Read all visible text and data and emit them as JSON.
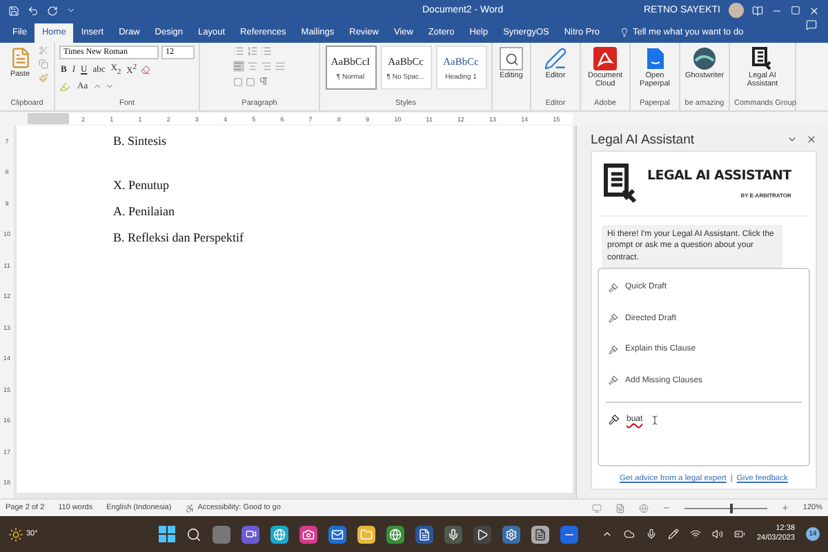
{
  "title_bar": {
    "title": "Document2 - Word",
    "user": "RETNO SAYEKTI"
  },
  "tabs": [
    {
      "label": "File",
      "selected": false
    },
    {
      "label": "Home",
      "selected": true
    },
    {
      "label": "Insert",
      "selected": false
    },
    {
      "label": "Draw",
      "selected": false
    },
    {
      "label": "Design",
      "selected": false
    },
    {
      "label": "Layout",
      "selected": false
    },
    {
      "label": "References",
      "selected": false
    },
    {
      "label": "Mailings",
      "selected": false
    },
    {
      "label": "Review",
      "selected": false
    },
    {
      "label": "View",
      "selected": false
    },
    {
      "label": "Zotero",
      "selected": false
    },
    {
      "label": "Help",
      "selected": false
    },
    {
      "label": "SynergyOS",
      "selected": false
    },
    {
      "label": "Nitro Pro",
      "selected": false
    }
  ],
  "tell_me": "Tell me what you want to do",
  "ribbon": {
    "clipboard": {
      "label": "Clipboard",
      "paste": "Paste"
    },
    "font": {
      "label": "Font",
      "font_name": "Times New Roman",
      "font_size": "12",
      "format_buttons": [
        "B",
        "I",
        "U",
        "abc",
        "X$_{2}$",
        "X$^{2}$"
      ],
      "case_button": "Aa"
    },
    "paragraph": {
      "label": "Paragraph"
    },
    "styles": {
      "label": "Styles",
      "items": [
        {
          "sample": "AaBbCcI",
          "name": "¶ Normal",
          "selected": true
        },
        {
          "sample": "AaBbCc",
          "name": "¶ No Spac...",
          "selected": false
        },
        {
          "sample": "AaBbCc",
          "name": "Heading 1",
          "selected": false
        }
      ]
    },
    "addins": [
      {
        "kind": "editing",
        "label": "Editing"
      },
      {
        "kind": "editor",
        "label": "Editor",
        "group": "Editor"
      },
      {
        "kind": "pdf",
        "label": "Document Cloud",
        "group": "Adobe"
      },
      {
        "kind": "paperpal",
        "label": "Open Paperpal",
        "group": "Paperpal"
      },
      {
        "kind": "ghost",
        "label": "Ghostwriter",
        "group": "be amazing"
      },
      {
        "kind": "legal",
        "label": "Legal AI Assistant",
        "group": "Commands Group"
      }
    ]
  },
  "ruler": {
    "horizontal": [
      "2",
      "1",
      "1",
      "2",
      "3",
      "4",
      "5",
      "6",
      "7",
      "8",
      "9",
      "10",
      "11",
      "12",
      "13",
      "14",
      "15"
    ],
    "vertical": [
      "7",
      "8",
      "9",
      "10",
      "11",
      "12",
      "13",
      "14",
      "15",
      "16",
      "17",
      "18"
    ]
  },
  "document": {
    "sections": [
      [
        "B. Sintesis"
      ],
      [
        "X. Penutup",
        "A. Penilaian",
        "B. Refleksi dan Perspektif"
      ]
    ]
  },
  "panel": {
    "title": "Legal AI Assistant",
    "logo_title": "LEGAL AI ASSISTANT",
    "logo_byline": "BY E-ARBITRATOR",
    "greeting": "Hi there! I'm your Legal AI Assistant. Click the prompt or ask me a question about your contract.",
    "prompts": [
      "Quick Draft",
      "Directed Draft",
      "Explain this Clause",
      "Add Missing Clauses"
    ],
    "input": {
      "value": "buat"
    },
    "links": [
      "Get advice from a legal expert",
      "Give feedback"
    ],
    "separator": "|"
  },
  "status_bar": {
    "items": [
      "Page 2 of 2",
      "110 words",
      "English (Indonesia)",
      "Accessibility: Good to go"
    ],
    "zoom": {
      "level": 0.55,
      "reading": "120%"
    }
  },
  "taskbar": {
    "weather": "30°",
    "time": "12:38",
    "date": "24/03/2023",
    "notifications": "14"
  }
}
